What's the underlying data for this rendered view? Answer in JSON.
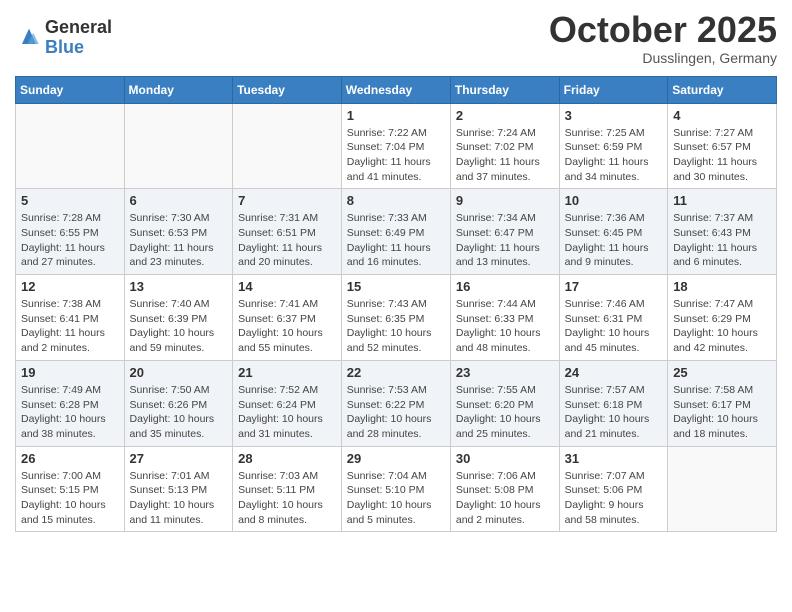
{
  "logo": {
    "general": "General",
    "blue": "Blue"
  },
  "title": "October 2025",
  "location": "Dusslingen, Germany",
  "days_of_week": [
    "Sunday",
    "Monday",
    "Tuesday",
    "Wednesday",
    "Thursday",
    "Friday",
    "Saturday"
  ],
  "weeks": [
    [
      {
        "num": "",
        "sunrise": "",
        "sunset": "",
        "daylight": ""
      },
      {
        "num": "",
        "sunrise": "",
        "sunset": "",
        "daylight": ""
      },
      {
        "num": "",
        "sunrise": "",
        "sunset": "",
        "daylight": ""
      },
      {
        "num": "1",
        "sunrise": "Sunrise: 7:22 AM",
        "sunset": "Sunset: 7:04 PM",
        "daylight": "Daylight: 11 hours and 41 minutes."
      },
      {
        "num": "2",
        "sunrise": "Sunrise: 7:24 AM",
        "sunset": "Sunset: 7:02 PM",
        "daylight": "Daylight: 11 hours and 37 minutes."
      },
      {
        "num": "3",
        "sunrise": "Sunrise: 7:25 AM",
        "sunset": "Sunset: 6:59 PM",
        "daylight": "Daylight: 11 hours and 34 minutes."
      },
      {
        "num": "4",
        "sunrise": "Sunrise: 7:27 AM",
        "sunset": "Sunset: 6:57 PM",
        "daylight": "Daylight: 11 hours and 30 minutes."
      }
    ],
    [
      {
        "num": "5",
        "sunrise": "Sunrise: 7:28 AM",
        "sunset": "Sunset: 6:55 PM",
        "daylight": "Daylight: 11 hours and 27 minutes."
      },
      {
        "num": "6",
        "sunrise": "Sunrise: 7:30 AM",
        "sunset": "Sunset: 6:53 PM",
        "daylight": "Daylight: 11 hours and 23 minutes."
      },
      {
        "num": "7",
        "sunrise": "Sunrise: 7:31 AM",
        "sunset": "Sunset: 6:51 PM",
        "daylight": "Daylight: 11 hours and 20 minutes."
      },
      {
        "num": "8",
        "sunrise": "Sunrise: 7:33 AM",
        "sunset": "Sunset: 6:49 PM",
        "daylight": "Daylight: 11 hours and 16 minutes."
      },
      {
        "num": "9",
        "sunrise": "Sunrise: 7:34 AM",
        "sunset": "Sunset: 6:47 PM",
        "daylight": "Daylight: 11 hours and 13 minutes."
      },
      {
        "num": "10",
        "sunrise": "Sunrise: 7:36 AM",
        "sunset": "Sunset: 6:45 PM",
        "daylight": "Daylight: 11 hours and 9 minutes."
      },
      {
        "num": "11",
        "sunrise": "Sunrise: 7:37 AM",
        "sunset": "Sunset: 6:43 PM",
        "daylight": "Daylight: 11 hours and 6 minutes."
      }
    ],
    [
      {
        "num": "12",
        "sunrise": "Sunrise: 7:38 AM",
        "sunset": "Sunset: 6:41 PM",
        "daylight": "Daylight: 11 hours and 2 minutes."
      },
      {
        "num": "13",
        "sunrise": "Sunrise: 7:40 AM",
        "sunset": "Sunset: 6:39 PM",
        "daylight": "Daylight: 10 hours and 59 minutes."
      },
      {
        "num": "14",
        "sunrise": "Sunrise: 7:41 AM",
        "sunset": "Sunset: 6:37 PM",
        "daylight": "Daylight: 10 hours and 55 minutes."
      },
      {
        "num": "15",
        "sunrise": "Sunrise: 7:43 AM",
        "sunset": "Sunset: 6:35 PM",
        "daylight": "Daylight: 10 hours and 52 minutes."
      },
      {
        "num": "16",
        "sunrise": "Sunrise: 7:44 AM",
        "sunset": "Sunset: 6:33 PM",
        "daylight": "Daylight: 10 hours and 48 minutes."
      },
      {
        "num": "17",
        "sunrise": "Sunrise: 7:46 AM",
        "sunset": "Sunset: 6:31 PM",
        "daylight": "Daylight: 10 hours and 45 minutes."
      },
      {
        "num": "18",
        "sunrise": "Sunrise: 7:47 AM",
        "sunset": "Sunset: 6:29 PM",
        "daylight": "Daylight: 10 hours and 42 minutes."
      }
    ],
    [
      {
        "num": "19",
        "sunrise": "Sunrise: 7:49 AM",
        "sunset": "Sunset: 6:28 PM",
        "daylight": "Daylight: 10 hours and 38 minutes."
      },
      {
        "num": "20",
        "sunrise": "Sunrise: 7:50 AM",
        "sunset": "Sunset: 6:26 PM",
        "daylight": "Daylight: 10 hours and 35 minutes."
      },
      {
        "num": "21",
        "sunrise": "Sunrise: 7:52 AM",
        "sunset": "Sunset: 6:24 PM",
        "daylight": "Daylight: 10 hours and 31 minutes."
      },
      {
        "num": "22",
        "sunrise": "Sunrise: 7:53 AM",
        "sunset": "Sunset: 6:22 PM",
        "daylight": "Daylight: 10 hours and 28 minutes."
      },
      {
        "num": "23",
        "sunrise": "Sunrise: 7:55 AM",
        "sunset": "Sunset: 6:20 PM",
        "daylight": "Daylight: 10 hours and 25 minutes."
      },
      {
        "num": "24",
        "sunrise": "Sunrise: 7:57 AM",
        "sunset": "Sunset: 6:18 PM",
        "daylight": "Daylight: 10 hours and 21 minutes."
      },
      {
        "num": "25",
        "sunrise": "Sunrise: 7:58 AM",
        "sunset": "Sunset: 6:17 PM",
        "daylight": "Daylight: 10 hours and 18 minutes."
      }
    ],
    [
      {
        "num": "26",
        "sunrise": "Sunrise: 7:00 AM",
        "sunset": "Sunset: 5:15 PM",
        "daylight": "Daylight: 10 hours and 15 minutes."
      },
      {
        "num": "27",
        "sunrise": "Sunrise: 7:01 AM",
        "sunset": "Sunset: 5:13 PM",
        "daylight": "Daylight: 10 hours and 11 minutes."
      },
      {
        "num": "28",
        "sunrise": "Sunrise: 7:03 AM",
        "sunset": "Sunset: 5:11 PM",
        "daylight": "Daylight: 10 hours and 8 minutes."
      },
      {
        "num": "29",
        "sunrise": "Sunrise: 7:04 AM",
        "sunset": "Sunset: 5:10 PM",
        "daylight": "Daylight: 10 hours and 5 minutes."
      },
      {
        "num": "30",
        "sunrise": "Sunrise: 7:06 AM",
        "sunset": "Sunset: 5:08 PM",
        "daylight": "Daylight: 10 hours and 2 minutes."
      },
      {
        "num": "31",
        "sunrise": "Sunrise: 7:07 AM",
        "sunset": "Sunset: 5:06 PM",
        "daylight": "Daylight: 9 hours and 58 minutes."
      },
      {
        "num": "",
        "sunrise": "",
        "sunset": "",
        "daylight": ""
      }
    ]
  ]
}
